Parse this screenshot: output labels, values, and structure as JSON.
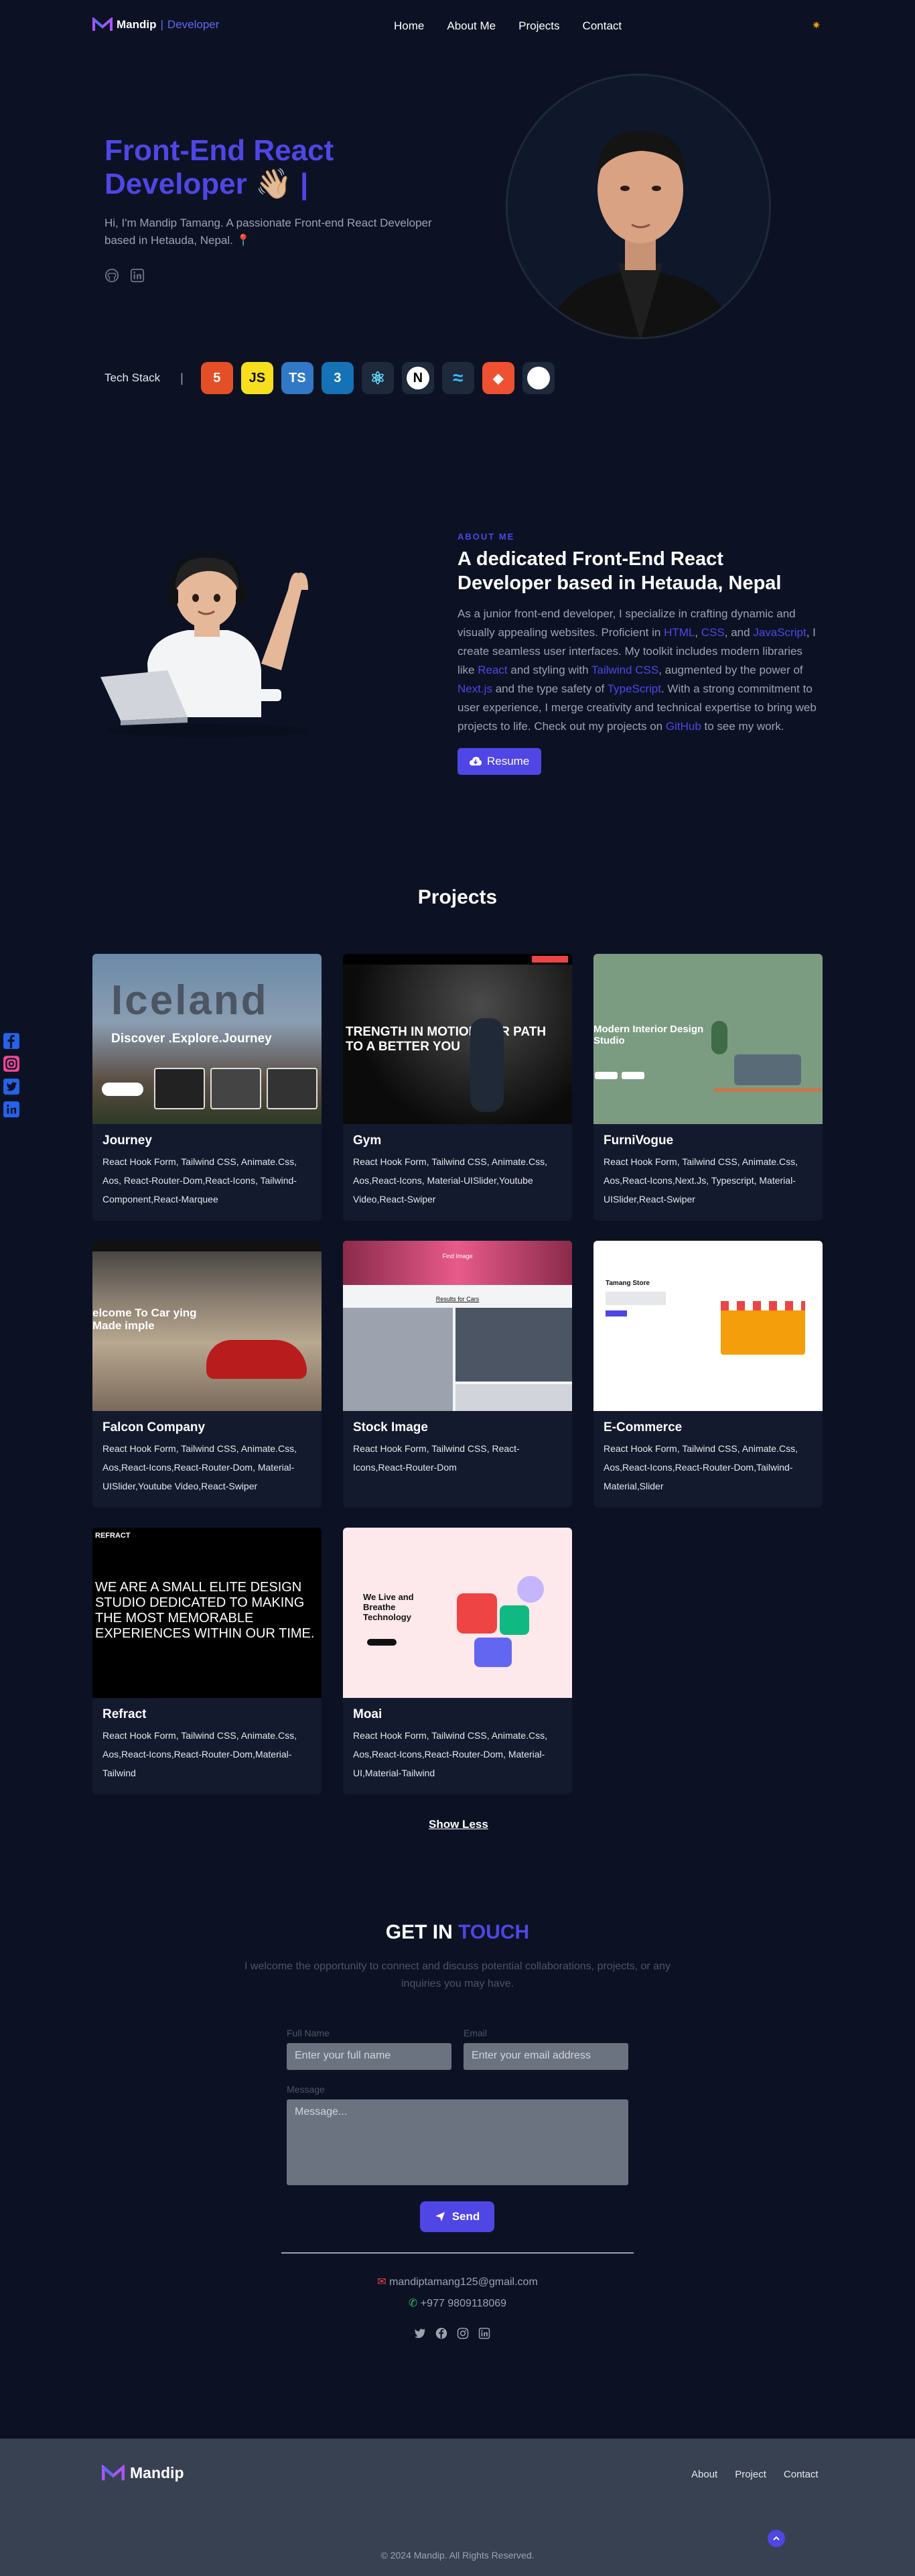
{
  "nav": {
    "brand": "Mandip",
    "brand_sep": "|",
    "brand_role": "Developer",
    "links": [
      "Home",
      "About Me",
      "Projects",
      "Contact"
    ],
    "theme_icon": "sun-icon"
  },
  "hero": {
    "title_line1": "Front-End React",
    "title_line2": "Developer 👋🏼 |",
    "subtitle": "Hi, I'm Mandip Tamang. A passionate Front-end React Developer based in Hetauda, Nepal. 📍",
    "icons": [
      "github-icon",
      "linkedin-icon"
    ]
  },
  "tech": {
    "label": "Tech Stack",
    "bar": "|",
    "badges": [
      {
        "name": "html5-icon",
        "text": "5",
        "color": "#e34f26"
      },
      {
        "name": "javascript-icon",
        "text": "JS",
        "color": "#f7df1e"
      },
      {
        "name": "typescript-icon",
        "text": "TS",
        "color": "#3178c6"
      },
      {
        "name": "css3-icon",
        "text": "3",
        "color": "#1572b6"
      },
      {
        "name": "react-icon",
        "text": "⚛",
        "color": "#1e293b"
      },
      {
        "name": "nextjs-icon",
        "text": "N",
        "color": "#1e293b"
      },
      {
        "name": "tailwind-icon",
        "text": "≈",
        "color": "#1e293b"
      },
      {
        "name": "git-icon",
        "text": "◆",
        "color": "#f05032"
      },
      {
        "name": "github-icon",
        "text": "●",
        "color": "#1e293b"
      }
    ]
  },
  "about": {
    "kicker": "ABOUT ME",
    "title": "A dedicated Front-End React Developer based in Hetauda, Nepal",
    "t1": "As a junior front-end developer, I specialize in crafting dynamic and visually appealing websites. Proficient in ",
    "h1": "HTML",
    "t2": ", ",
    "h2": "CSS",
    "t3": ", and ",
    "h3": "JavaScript",
    "t4": ", I create seamless user interfaces. My toolkit includes modern libraries like ",
    "h4": "React",
    "t5": " and styling with ",
    "h5": "Tailwind CSS",
    "t6": ", augmented by the power of ",
    "h6": "Next.js",
    "t7": " and the type safety of ",
    "h7": "TypeScript",
    "t8": ". With a strong commitment to user experience, I merge creativity and technical expertise to bring web projects to life. Check out my projects on ",
    "h8": "GitHub",
    "t9": " to see my work.",
    "resume": "Resume"
  },
  "projects": {
    "title": "Projects",
    "show_less": "Show Less",
    "items": [
      {
        "name": "Journey",
        "tags": "React Hook Form, Tailwind CSS, Animate.Css, Aos, React-Router-Dom,React-Icons, Tailwind-Component,React-Marquee",
        "thumb_text": "Iceland",
        "thumb_sub": "Discover .Explore.Journey"
      },
      {
        "name": "Gym",
        "tags": "React Hook Form, Tailwind CSS, Animate.Css, Aos,React-Icons, Material-UISlider,Youtube Video,React-Swiper",
        "thumb_text": "TRENGTH IN MOTION OUR PATH TO A BETTER YOU",
        "thumb_sub": ""
      },
      {
        "name": "FurniVogue",
        "tags": "React Hook Form, Tailwind CSS, Animate.Css, Aos,React-Icons,Next.Js, Typescript, Material-UISlider,React-Swiper",
        "thumb_text": "Modern Interior Design Studio",
        "thumb_sub": ""
      },
      {
        "name": "Falcon Company",
        "tags": "React Hook Form, Tailwind CSS, Animate.Css, Aos,React-Icons,React-Router-Dom, Material-UISlider,Youtube Video,React-Swiper",
        "thumb_text": "elcome To Car ying Made imple",
        "thumb_sub": ""
      },
      {
        "name": "Stock Image",
        "tags": "React Hook Form, Tailwind CSS, React-Icons,React-Router-Dom",
        "thumb_text": "Find Image",
        "thumb_sub": "Results for Cars"
      },
      {
        "name": "E-Commerce",
        "tags": "React Hook Form, Tailwind CSS, Animate.Css, Aos,React-Icons,React-Router-Dom,Tailwind-Material,Slider",
        "thumb_text": "Tamang Store",
        "thumb_sub": ""
      },
      {
        "name": "Refract",
        "tags": "React Hook Form, Tailwind CSS, Animate.Css, Aos,React-Icons,React-Router-Dom,Material-Tailwind",
        "thumb_text": "WE ARE A SMALL ELITE DESIGN STUDIO DEDICATED TO MAKING THE MOST MEMORABLE EXPERIENCES WITHIN OUR TIME.",
        "thumb_sub": "REFRACT"
      },
      {
        "name": "Moai",
        "tags": "React Hook Form, Tailwind CSS, Animate.Css, Aos,React-Icons,React-Router-Dom, Material-UI,Material-Tailwind",
        "thumb_text": "We Live and Breathe Technology",
        "thumb_sub": ""
      }
    ]
  },
  "contact": {
    "title_a": "GET IN",
    "title_b": "TOUCH",
    "subtitle": "I welcome the opportunity to connect and discuss potential collaborations, projects, or any inquiries you may have.",
    "name_label": "Full Name",
    "name_placeholder": "Enter your full name",
    "email_label": "Email",
    "email_placeholder": "Enter your email address",
    "message_label": "Message",
    "message_placeholder": "Message...",
    "send": "Send",
    "email": "mandiptamang125@gmail.com",
    "phone": "+977 9809118069"
  },
  "footer": {
    "brand": "Mandip",
    "links": [
      "About",
      "Project",
      "Contact"
    ],
    "copyright": "© 2024 Mandip. All Rights Reserved."
  }
}
